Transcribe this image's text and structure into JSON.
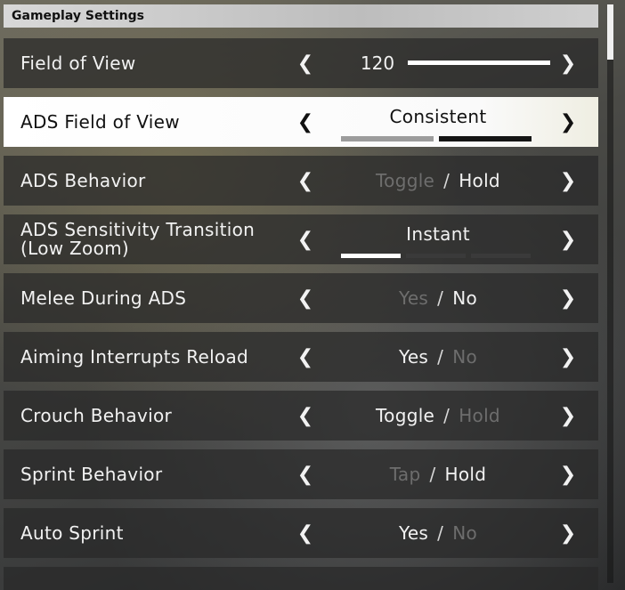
{
  "header": {
    "title": "Gameplay Settings"
  },
  "settings": {
    "fov": {
      "label": "Field of View",
      "value": "120",
      "level": 1.0
    },
    "ads_fov": {
      "label": "ADS Field of View",
      "value": "Consistent",
      "segments": 2,
      "active_segment": 2
    },
    "ads_behavior": {
      "label": "ADS Behavior",
      "options": [
        "Toggle",
        "Hold"
      ],
      "selected": "Hold"
    },
    "ads_sens": {
      "label": "ADS Sensitivity Transition (Low Zoom)",
      "value": "Instant",
      "segments": 3,
      "active_segment": 1
    },
    "melee_ads": {
      "label": "Melee During ADS",
      "options": [
        "Yes",
        "No"
      ],
      "selected": "No"
    },
    "aim_interrupt": {
      "label": "Aiming Interrupts Reload",
      "options": [
        "Yes",
        "No"
      ],
      "selected": "Yes"
    },
    "crouch": {
      "label": "Crouch Behavior",
      "options": [
        "Toggle",
        "Hold"
      ],
      "selected": "Toggle"
    },
    "sprint": {
      "label": "Sprint Behavior",
      "options": [
        "Tap",
        "Hold"
      ],
      "selected": "Hold"
    },
    "auto_sprint": {
      "label": "Auto Sprint",
      "options": [
        "Yes",
        "No"
      ],
      "selected": "Yes"
    }
  },
  "separator": "/",
  "icons": {
    "left": "chevron-left-icon",
    "right": "chevron-right-icon"
  }
}
